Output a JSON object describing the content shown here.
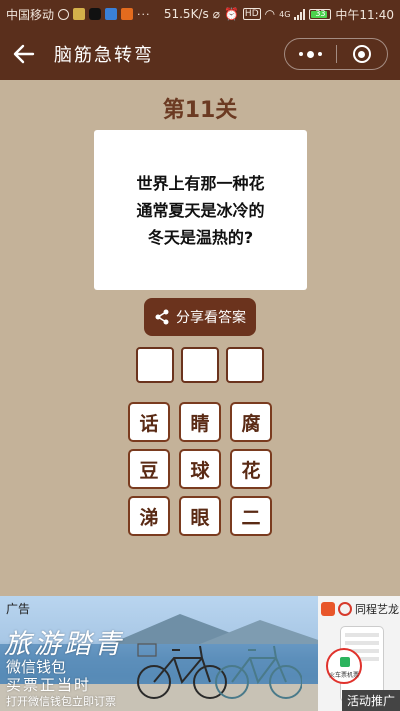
{
  "status_bar": {
    "carrier": "中国移动",
    "network_speed": "51.5K/s",
    "network_type": "4G",
    "battery_level": "33",
    "time": "中午11:40",
    "hd_label": "HD"
  },
  "nav": {
    "title": "脑筋急转弯",
    "back_icon": "arrow-left-icon",
    "more_icon": "more-dots-icon",
    "close_icon": "target-circle-icon"
  },
  "game": {
    "level_title": "第11关",
    "question_lines": [
      "世界上有那一种花",
      "通常夏天是冰冷的",
      "冬天是温热的?"
    ],
    "share_button_label": "分享看答案",
    "answer_slots": 3,
    "candidate_chars": [
      "话",
      "睛",
      "腐",
      "豆",
      "球",
      "花",
      "涕",
      "眼",
      "二"
    ]
  },
  "ad": {
    "tag": "广告",
    "headline": "旅游踏青",
    "line1": "微信钱包",
    "line2": "买票正当时",
    "line3": "打开微信钱包立即订票",
    "side_brand": "同程艺龙",
    "side_phone_label": "火车票机票",
    "promo_label": "活动推广"
  },
  "colors": {
    "bar_bg": "#5a2f1c",
    "page_bg": "#c4b299",
    "level_text": "#6b3a22",
    "button_bg": "#6b331d",
    "tile_border": "#7a3b1f"
  }
}
